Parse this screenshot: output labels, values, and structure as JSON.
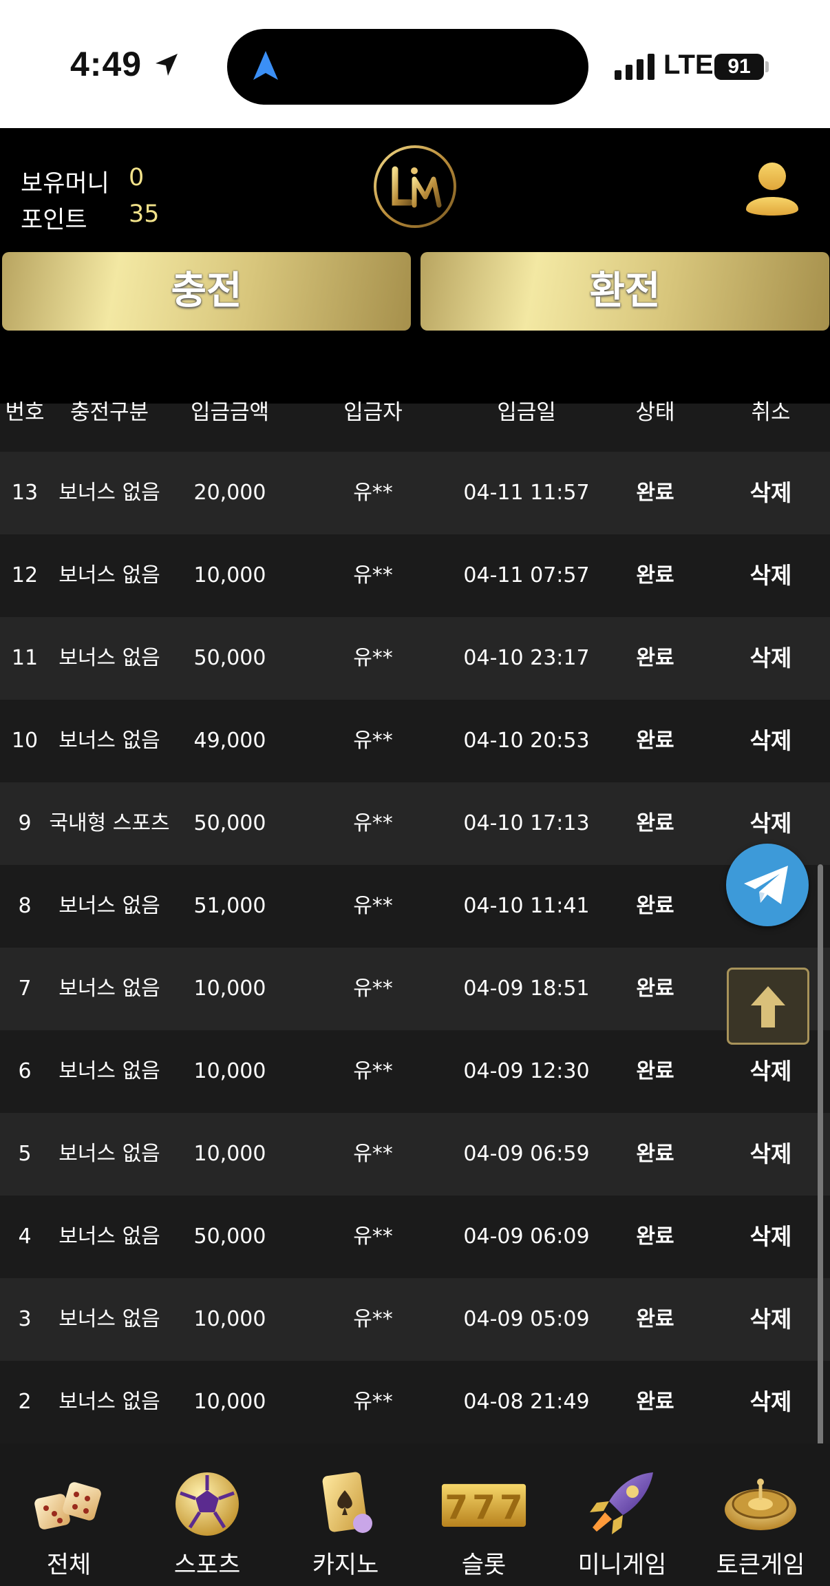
{
  "status_bar": {
    "time": "4:49",
    "network": "LTE",
    "battery": "91"
  },
  "header": {
    "balance_label": "보유머니",
    "balance_value": "0",
    "points_label": "포인트",
    "points_value": "35",
    "charge_button": "충전",
    "exchange_button": "환전"
  },
  "table": {
    "columns": [
      "번호",
      "충전구분",
      "입금금액",
      "입금자",
      "입금일",
      "상태",
      "취소"
    ],
    "rows": [
      {
        "no": "13",
        "type": "보너스 없음",
        "amount": "20,000",
        "depositor": "유**",
        "date": "04-11 11:57",
        "status": "완료",
        "cancel": "삭제"
      },
      {
        "no": "12",
        "type": "보너스 없음",
        "amount": "10,000",
        "depositor": "유**",
        "date": "04-11 07:57",
        "status": "완료",
        "cancel": "삭제"
      },
      {
        "no": "11",
        "type": "보너스 없음",
        "amount": "50,000",
        "depositor": "유**",
        "date": "04-10 23:17",
        "status": "완료",
        "cancel": "삭제"
      },
      {
        "no": "10",
        "type": "보너스 없음",
        "amount": "49,000",
        "depositor": "유**",
        "date": "04-10 20:53",
        "status": "완료",
        "cancel": "삭제"
      },
      {
        "no": "9",
        "type": "국내형 스포츠",
        "amount": "50,000",
        "depositor": "유**",
        "date": "04-10 17:13",
        "status": "완료",
        "cancel": "삭제"
      },
      {
        "no": "8",
        "type": "보너스 없음",
        "amount": "51,000",
        "depositor": "유**",
        "date": "04-10 11:41",
        "status": "완료",
        "cancel": ""
      },
      {
        "no": "7",
        "type": "보너스 없음",
        "amount": "10,000",
        "depositor": "유**",
        "date": "04-09 18:51",
        "status": "완료",
        "cancel": ""
      },
      {
        "no": "6",
        "type": "보너스 없음",
        "amount": "10,000",
        "depositor": "유**",
        "date": "04-09 12:30",
        "status": "완료",
        "cancel": "삭제"
      },
      {
        "no": "5",
        "type": "보너스 없음",
        "amount": "10,000",
        "depositor": "유**",
        "date": "04-09 06:59",
        "status": "완료",
        "cancel": "삭제"
      },
      {
        "no": "4",
        "type": "보너스 없음",
        "amount": "50,000",
        "depositor": "유**",
        "date": "04-09 06:09",
        "status": "완료",
        "cancel": "삭제"
      },
      {
        "no": "3",
        "type": "보너스 없음",
        "amount": "10,000",
        "depositor": "유**",
        "date": "04-09 05:09",
        "status": "완료",
        "cancel": "삭제"
      },
      {
        "no": "2",
        "type": "보너스 없음",
        "amount": "10,000",
        "depositor": "유**",
        "date": "04-08 21:49",
        "status": "완료",
        "cancel": "삭제"
      }
    ]
  },
  "bottom_nav": [
    {
      "label": "전체",
      "icon": "dice-icon"
    },
    {
      "label": "스포츠",
      "icon": "soccer-ball-icon"
    },
    {
      "label": "카지노",
      "icon": "playing-cards-icon"
    },
    {
      "label": "슬롯",
      "icon": "slot-777-icon"
    },
    {
      "label": "미니게임",
      "icon": "rocket-icon"
    },
    {
      "label": "토큰게임",
      "icon": "roulette-icon"
    }
  ],
  "colors": {
    "accent_gold": "#f2e28a",
    "telegram_blue": "#3d9ad9",
    "row_dark": "#1b1b1b",
    "row_light": "#262626"
  }
}
